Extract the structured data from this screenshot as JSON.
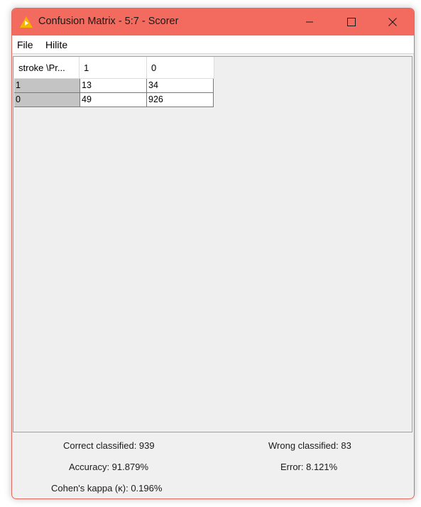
{
  "window": {
    "title": "Confusion Matrix - 5:7 - Scorer",
    "colors": {
      "titlebar": "#f36b5f",
      "icon": "#f5b400"
    },
    "icons": {
      "app": "knime-triangle-icon",
      "minimize": "minimize-icon",
      "maximize": "maximize-icon",
      "close": "close-icon"
    }
  },
  "menu": {
    "file": "File",
    "hilite": "Hilite"
  },
  "table": {
    "corner_header": "stroke \\Pr...",
    "col_headers": [
      "1",
      "0"
    ],
    "rows": [
      {
        "label": "1",
        "values": [
          "13",
          "34"
        ]
      },
      {
        "label": "0",
        "values": [
          "49",
          "926"
        ]
      }
    ]
  },
  "stats": {
    "correct": "Correct classified:  939",
    "wrong": "Wrong classified:  83",
    "accuracy": "Accuracy:  91.879%",
    "error": "Error:  8.121%",
    "kappa": "Cohen's kappa (κ):  0.196%"
  }
}
